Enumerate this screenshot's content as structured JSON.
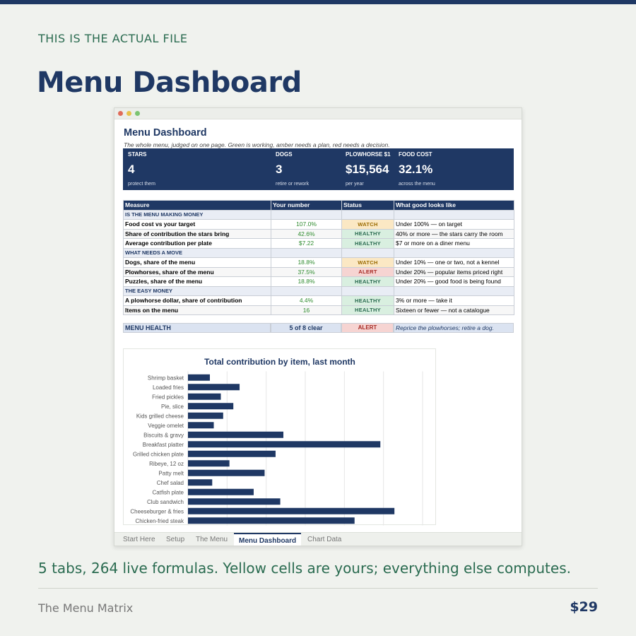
{
  "page": {
    "eyebrow": "THIS IS THE ACTUAL FILE",
    "headline": "Menu Dashboard",
    "tagline": "5 tabs, 264 live formulas. Yellow cells are yours; everything else computes.",
    "product": "The Menu Matrix",
    "price": "$29",
    "colors": {
      "navy": "#1f3864",
      "green": "#2a6b50",
      "background": "#f0f2ee"
    }
  },
  "sheet": {
    "title": "Menu Dashboard",
    "subtitle": "The whole menu, judged on one page. Green is working, amber needs a plan, red needs a decision.",
    "kpis": [
      {
        "label": "STARS",
        "value": "4",
        "note": "protect them"
      },
      {
        "label": "DOGS",
        "value": "3",
        "note": "retire or rework"
      },
      {
        "label": "PLOWHORSE $1",
        "value": "$15,564",
        "note": "per year"
      },
      {
        "label": "FOOD COST",
        "value": "32.1%",
        "note": "across the menu"
      }
    ],
    "table": {
      "headers": [
        "Measure",
        "Your number",
        "Status",
        "What good looks like"
      ],
      "sections": [
        {
          "title": "IS THE MENU MAKING MONEY",
          "rows": [
            {
              "measure": "Food cost vs your target",
              "number": "107.0%",
              "status": "WATCH",
              "good": "Under 100% — on target"
            },
            {
              "measure": "Share of contribution the stars bring",
              "number": "42.6%",
              "status": "HEALTHY",
              "good": "40% or more — the stars carry the room"
            },
            {
              "measure": "Average contribution per plate",
              "number": "$7.22",
              "status": "HEALTHY",
              "good": "$7 or more on a diner menu"
            }
          ]
        },
        {
          "title": "WHAT NEEDS A MOVE",
          "rows": [
            {
              "measure": "Dogs, share of the menu",
              "number": "18.8%",
              "status": "WATCH",
              "good": "Under 10% — one or two, not a kennel"
            },
            {
              "measure": "Plowhorses, share of the menu",
              "number": "37.5%",
              "status": "ALERT",
              "good": "Under 20% — popular items priced right"
            },
            {
              "measure": "Puzzles, share of the menu",
              "number": "18.8%",
              "status": "HEALTHY",
              "good": "Under 20% — good food is being found"
            }
          ]
        },
        {
          "title": "THE EASY MONEY",
          "rows": [
            {
              "measure": "A plowhorse dollar, share of contribution",
              "number": "4.4%",
              "status": "HEALTHY",
              "good": "3% or more — take it"
            },
            {
              "measure": "Items on the menu",
              "number": "16",
              "status": "HEALTHY",
              "good": "Sixteen or fewer — not a catalogue"
            }
          ]
        }
      ]
    },
    "health": {
      "label": "MENU HEALTH",
      "score": "5 of 8 clear",
      "status": "ALERT",
      "note": "Reprice the plowhorses; retire a dog."
    },
    "tabs": [
      "Start Here",
      "Setup",
      "The Menu",
      "Menu Dashboard",
      "Chart Data"
    ],
    "active_tab": "Menu Dashboard"
  },
  "chart_data": {
    "type": "bar",
    "orientation": "horizontal",
    "title": "Total contribution by item, last month",
    "xlabel": "",
    "ylabel": "",
    "grid": true,
    "categories": [
      "Shrimp basket",
      "Loaded fries",
      "Fried pickles",
      "Pie, slice",
      "Kids grilled cheese",
      "Veggie omelet",
      "Biscuits & gravy",
      "Breakfast platter",
      "Grilled chicken plate",
      "Ribeye, 12 oz",
      "Patty melt",
      "Chef salad",
      "Catfish plate",
      "Club sandwich",
      "Cheeseburger & fries",
      "Chicken-fried steak"
    ],
    "values": [
      28,
      66,
      42,
      58,
      45,
      33,
      122,
      246,
      112,
      53,
      98,
      31,
      84,
      118,
      264,
      213
    ],
    "xlim": [
      0,
      300
    ],
    "color": "#1f3864"
  }
}
